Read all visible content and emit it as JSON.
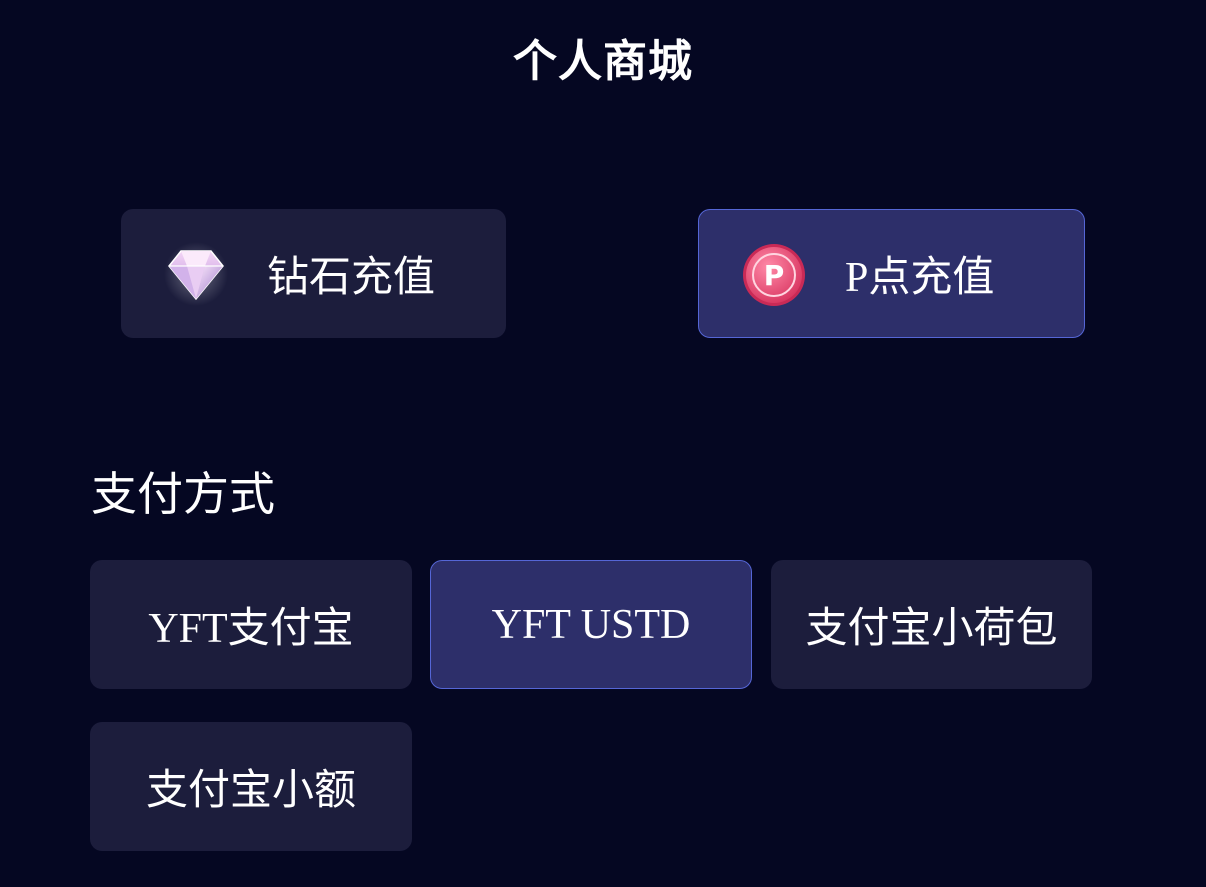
{
  "header": {
    "title": "个人商城"
  },
  "recharge_options": [
    {
      "label": "钻石充值",
      "icon": "diamond-icon",
      "selected": false
    },
    {
      "label": "P点充值",
      "icon": "p-coin-icon",
      "selected": true
    }
  ],
  "payment": {
    "section_label": "支付方式",
    "methods": [
      {
        "label": "YFT支付宝",
        "selected": false
      },
      {
        "label": "YFT USTD",
        "selected": true
      },
      {
        "label": "支付宝小荷包",
        "selected": false
      },
      {
        "label": "支付宝小额",
        "selected": false
      }
    ]
  },
  "colors": {
    "background": "#050722",
    "card": "#1c1d3c",
    "card_selected": "#2d2f6a",
    "selected_border": "#5566d6",
    "coin_pink": "#e8507a"
  }
}
